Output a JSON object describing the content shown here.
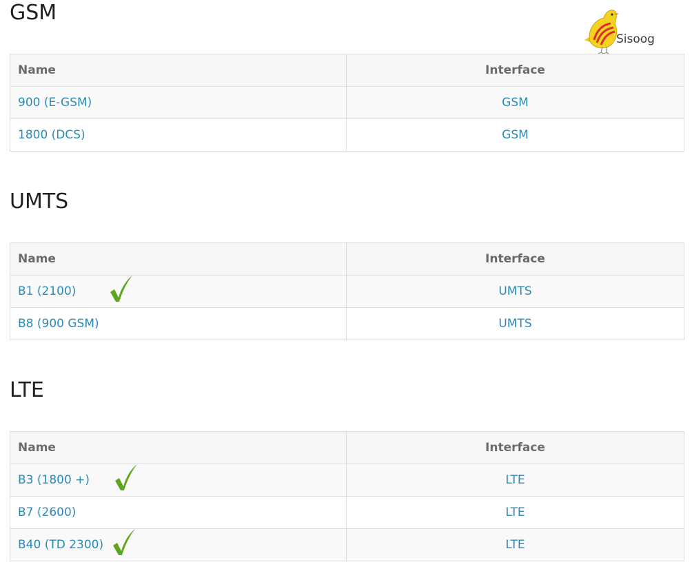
{
  "logo": {
    "text": "Sisoog",
    "icon": "bird-logo-icon",
    "colors": {
      "body": "#f5d21f",
      "stripe": "#d7312a",
      "text": "#3a3a3a"
    }
  },
  "accent_colors": {
    "link": "#2a8ab8",
    "check": "#5fa620",
    "header_text": "#6b6b6b",
    "border": "#dcdcdc"
  },
  "sections": {
    "gsm": {
      "title": "GSM",
      "columns": {
        "name": "Name",
        "interface": "Interface"
      },
      "rows": [
        {
          "name": "900 (E-GSM)",
          "interface": "GSM",
          "checked": false
        },
        {
          "name": "1800 (DCS)",
          "interface": "GSM",
          "checked": false
        }
      ]
    },
    "umts": {
      "title": "UMTS",
      "columns": {
        "name": "Name",
        "interface": "Interface"
      },
      "rows": [
        {
          "name": "B1 (2100)",
          "interface": "UMTS",
          "checked": true,
          "check_icon": "checkmark-icon"
        },
        {
          "name": "B8 (900 GSM)",
          "interface": "UMTS",
          "checked": false
        }
      ]
    },
    "lte": {
      "title": "LTE",
      "columns": {
        "name": "Name",
        "interface": "Interface"
      },
      "rows": [
        {
          "name": "B3 (1800 +)",
          "interface": "LTE",
          "checked": true,
          "check_icon": "checkmark-icon"
        },
        {
          "name": "B7 (2600)",
          "interface": "LTE",
          "checked": false
        },
        {
          "name": "B40 (TD 2300)",
          "interface": "LTE",
          "checked": true,
          "check_icon": "checkmark-icon"
        }
      ]
    }
  }
}
